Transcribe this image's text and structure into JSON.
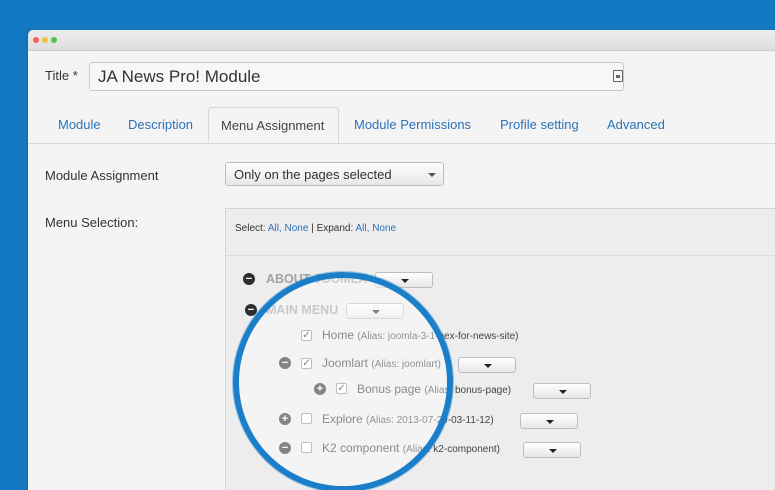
{
  "title": {
    "label": "Title *",
    "value": "JA News Pro! Module"
  },
  "tabs": [
    {
      "label": "Module"
    },
    {
      "label": "Description"
    },
    {
      "label": "Menu Assignment"
    },
    {
      "label": "Module Permissions"
    },
    {
      "label": "Profile setting"
    },
    {
      "label": "Advanced"
    }
  ],
  "assignment": {
    "label": "Module Assignment",
    "selected": "Only on the pages selected"
  },
  "menu_selection": {
    "label": "Menu Selection:",
    "select_label": "Select:",
    "all": "All,",
    "none": "None",
    "separator": "|",
    "expand_label": "Expand:",
    "expand_all": "All,",
    "expand_none": "None"
  },
  "tree": {
    "about": "ABOUT JOOMLA",
    "main": "MAIN MENU",
    "items": [
      {
        "title": "Home",
        "alias": "(Alias: joomla-3-1-nex-for-news-site)"
      },
      {
        "title": "Joomlart",
        "alias": "(Alias: joomlart)"
      },
      {
        "title": "Bonus page",
        "alias": "(Alias: bonus-page)"
      },
      {
        "title": "Explore",
        "alias": "(Alias: 2013-07-29-03-11-12)"
      },
      {
        "title": "K2 component",
        "alias": "(Alias: k2-component)"
      }
    ],
    "check_glyph": "✓",
    "minus": "−",
    "plus": "+"
  },
  "colors": {
    "background": "#1279c2",
    "link": "#2a74b8",
    "lens": "#1a7fc8"
  }
}
